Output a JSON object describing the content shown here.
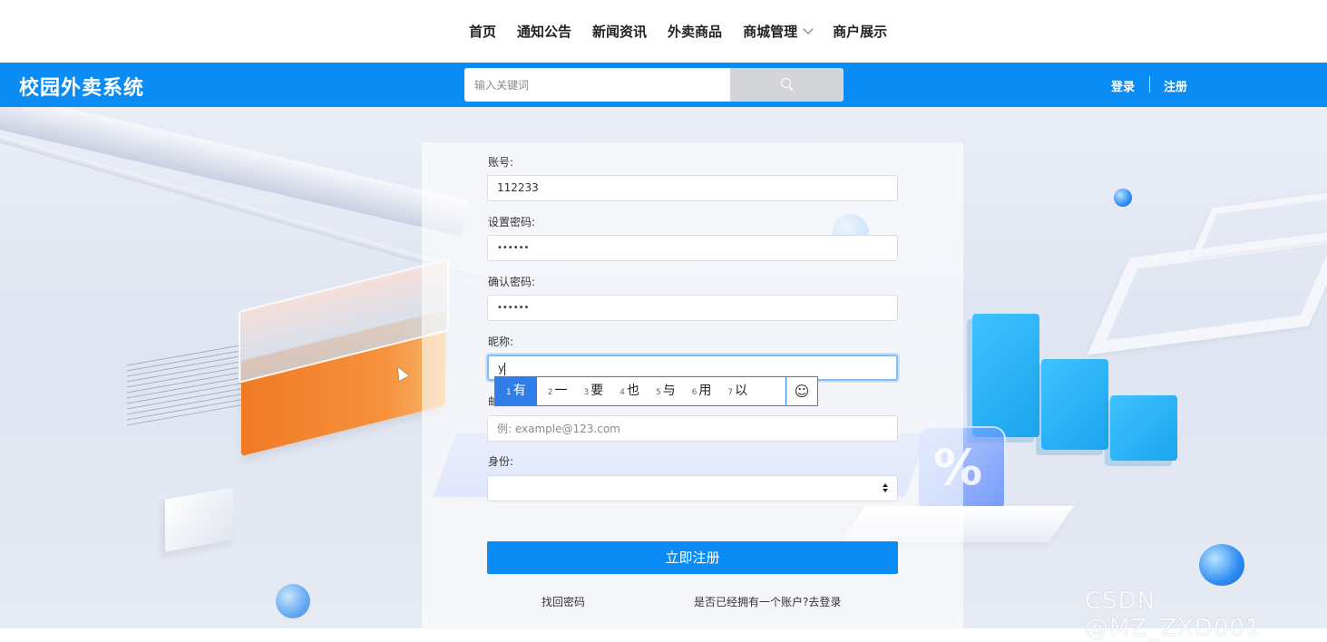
{
  "nav": {
    "items": [
      {
        "label": "首页"
      },
      {
        "label": "通知公告"
      },
      {
        "label": "新闻资讯"
      },
      {
        "label": "外卖商品"
      },
      {
        "label": "商城管理",
        "has_dropdown": true
      },
      {
        "label": "商户展示"
      }
    ]
  },
  "header": {
    "brand": "校园外卖系统",
    "search_placeholder": "输入关键词",
    "login_label": "登录",
    "register_label": "注册",
    "accent_color": "#0b8cf5"
  },
  "form": {
    "account_label": "账号:",
    "account_value": "112233",
    "password_label": "设置密码:",
    "password_value": "••••••",
    "confirm_label": "确认密码:",
    "confirm_value": "••••••",
    "nickname_label": "昵称:",
    "nickname_value": "y",
    "email_label_partial": "邮",
    "email_placeholder": "例: example@123.com",
    "identity_label": "身份:",
    "identity_value": "",
    "submit_label": "立即注册",
    "forgot_label": "找回密码",
    "have_account_label": "是否已经拥有一个账户?去登录"
  },
  "ime": {
    "candidates": [
      {
        "num": "1",
        "text": "有"
      },
      {
        "num": "2",
        "text": "一"
      },
      {
        "num": "3",
        "text": "要"
      },
      {
        "num": "4",
        "text": "也"
      },
      {
        "num": "5",
        "text": "与"
      },
      {
        "num": "6",
        "text": "用"
      },
      {
        "num": "7",
        "text": "以"
      }
    ],
    "emoji_icon": "smiley-icon"
  },
  "watermark": "CSDN @MZ_ZXD001"
}
